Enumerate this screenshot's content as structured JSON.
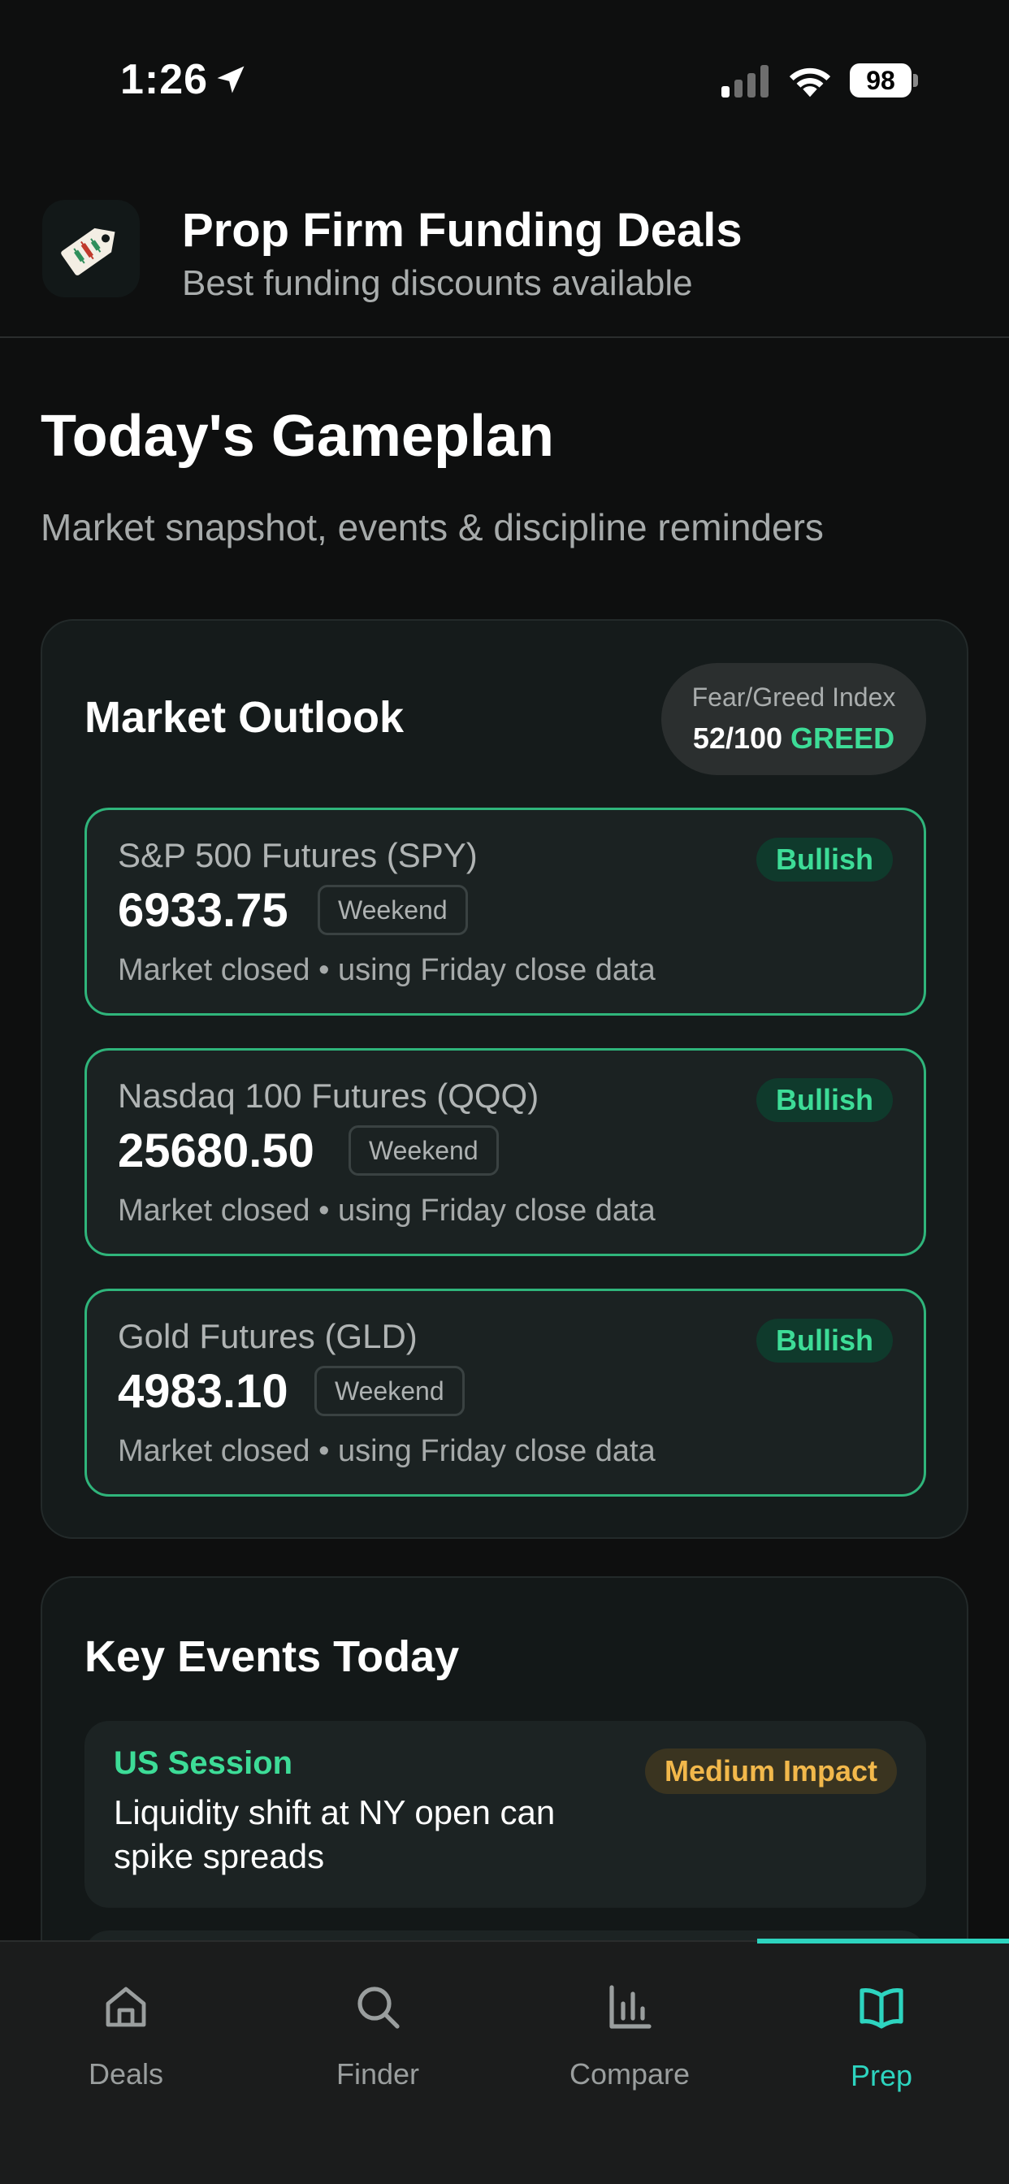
{
  "status_bar": {
    "time": "1:26",
    "battery": "98"
  },
  "app": {
    "title": "Prop Firm Funding Deals",
    "subtitle": "Best funding discounts available",
    "logo_icon": "price-tag-candlestick-icon"
  },
  "page": {
    "title": "Today's Gameplan",
    "subtitle": "Market snapshot, events & discipline reminders"
  },
  "market_outlook": {
    "title": "Market Outlook",
    "fear_greed": {
      "label": "Fear/Greed Index",
      "value": "52/100",
      "sentiment": "GREED"
    },
    "tickers": [
      {
        "name": "S&P 500 Futures (SPY)",
        "price": "6933.75",
        "tag": "Weekend",
        "badge": "Bullish",
        "note": "Market closed • using Friday close data"
      },
      {
        "name": "Nasdaq 100 Futures (QQQ)",
        "price": "25680.50",
        "tag": "Weekend",
        "badge": "Bullish",
        "note": "Market closed • using Friday close data"
      },
      {
        "name": "Gold Futures (GLD)",
        "price": "4983.10",
        "tag": "Weekend",
        "badge": "Bullish",
        "note": "Market closed • using Friday close data"
      }
    ]
  },
  "key_events": {
    "title": "Key Events Today",
    "items": [
      {
        "session": "US Session",
        "description": "Liquidity shift at NY open can spike spreads",
        "impact": "Medium Impact"
      }
    ]
  },
  "tabs": [
    {
      "label": "Deals",
      "icon": "home-icon",
      "active": false
    },
    {
      "label": "Finder",
      "icon": "search-icon",
      "active": false
    },
    {
      "label": "Compare",
      "icon": "bar-chart-icon",
      "active": false
    },
    {
      "label": "Prep",
      "icon": "book-icon",
      "active": true
    }
  ],
  "colors": {
    "accent_green": "#3ddc97",
    "accent_teal": "#2dd4bf",
    "impact_amber": "#f2b84b",
    "background": "#0e0f0f"
  }
}
